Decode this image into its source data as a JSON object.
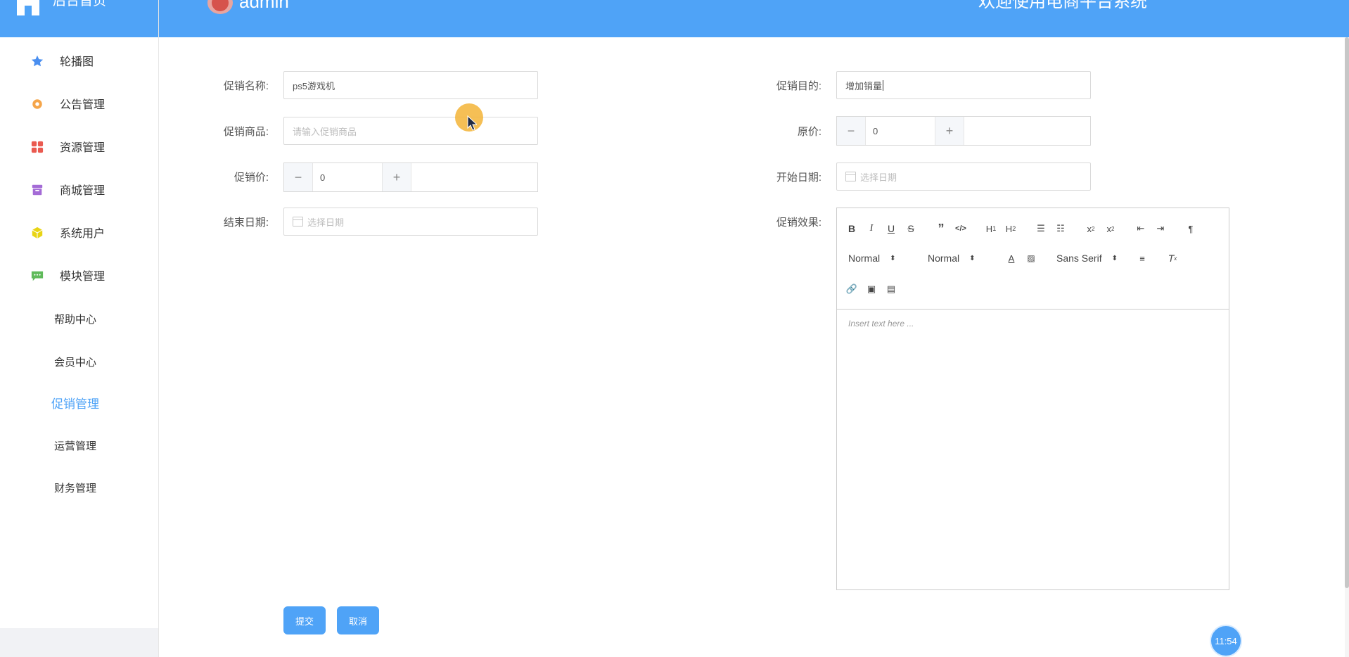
{
  "sidebar": {
    "home_label": "后台首页",
    "items": [
      {
        "label": "轮播图",
        "icon": "star-icon",
        "color": "#4a8ff0"
      },
      {
        "label": "公告管理",
        "icon": "gear-icon",
        "color": "#f5a54a"
      },
      {
        "label": "资源管理",
        "icon": "grid-icon",
        "color": "#ea5a50"
      },
      {
        "label": "商城管理",
        "icon": "box-icon",
        "color": "#a46bd6"
      },
      {
        "label": "系统用户",
        "icon": "cube-icon",
        "color": "#e8d414"
      },
      {
        "label": "模块管理",
        "icon": "chat-icon",
        "color": "#5fba5a"
      }
    ],
    "sub_items": [
      {
        "label": "帮助中心",
        "active": false
      },
      {
        "label": "会员中心",
        "active": false
      },
      {
        "label": "促销管理",
        "active": true
      },
      {
        "label": "运营管理",
        "active": false
      },
      {
        "label": "财务管理",
        "active": false
      }
    ]
  },
  "header": {
    "username": "admin",
    "welcome": "欢迎使用电商平台系统",
    "bg_color": "#4fa3f7"
  },
  "form": {
    "name_label": "促销名称:",
    "name_value": "ps5游戏机",
    "goal_label": "促销目的:",
    "goal_value": "增加销量",
    "product_label": "促销商品:",
    "product_placeholder": "请输入促销商品",
    "orig_price_label": "原价:",
    "orig_price_value": "0",
    "promo_price_label": "促销价:",
    "promo_price_value": "0",
    "start_date_label": "开始日期:",
    "start_date_placeholder": "选择日期",
    "end_date_label": "结束日期:",
    "end_date_placeholder": "选择日期",
    "effect_label": "促销效果:"
  },
  "editor": {
    "header_select": "Normal",
    "size_select": "Normal",
    "font_select": "Sans Serif",
    "placeholder": "Insert text here ..."
  },
  "buttons": {
    "submit": "提交",
    "cancel": "取消"
  },
  "clock": "11:54"
}
